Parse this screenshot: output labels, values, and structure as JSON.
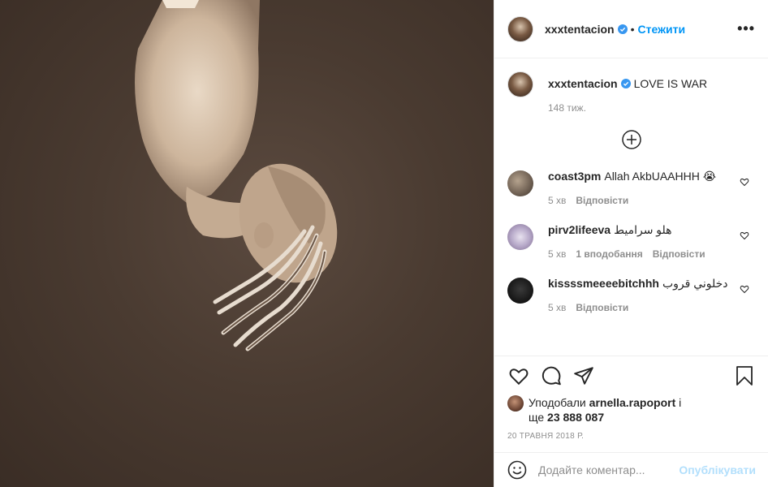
{
  "header": {
    "username": "xxxtentacion",
    "separator": "•",
    "follow_label": "Стежити",
    "more_label": "•••"
  },
  "caption": {
    "username": "xxxtentacion",
    "text": "LOVE IS WAR",
    "time": "148 тиж."
  },
  "comments": [
    {
      "username": "coast3pm",
      "text": "Allah AkbUAAHHH 😭",
      "time": "5 хв",
      "likes": "",
      "reply": "Відповісти"
    },
    {
      "username": "pirv2lifeeva",
      "text": "هلو سراميط",
      "time": "5 хв",
      "likes": "1 вподобання",
      "reply": "Відповісти"
    },
    {
      "username": "kissssmeeeebitchhh",
      "text": "دخلوني قروب",
      "time": "5 хв",
      "likes": "",
      "reply": "Відповісти"
    }
  ],
  "likes": {
    "prefix": "Уподобали",
    "user": "arnella.rapoport",
    "middle": "і",
    "more_prefix": "ще",
    "count": "23 888 087"
  },
  "date": "20 травня 2018 р.",
  "add_comment": {
    "placeholder": "Додайте коментар...",
    "publish_label": "Опублікувати"
  },
  "colors": {
    "accent": "#0095f6",
    "publish_disabled": "#b2dffc",
    "muted": "#8e8e8e"
  }
}
